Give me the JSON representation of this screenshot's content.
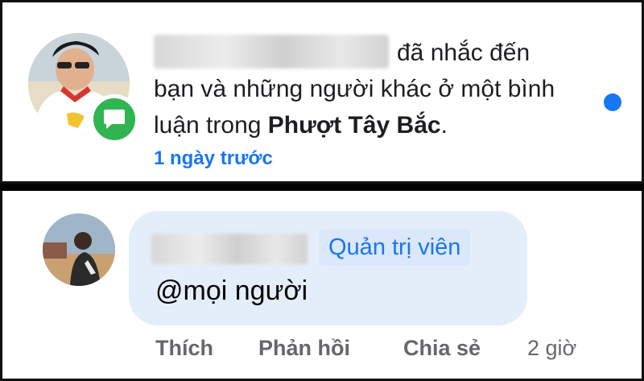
{
  "notification": {
    "text_mid": "đã nhắc đến bạn và những người khác ở một bình luận trong",
    "group_name": "Phượt Tây Bắc",
    "text_end": ".",
    "time_ago": "1 ngày trước",
    "badge_icon": "message-bubble-icon",
    "accent_color": "#1877f2",
    "badge_color": "#2fb551"
  },
  "comment": {
    "admin_label": "Quản trị viên",
    "body": "@mọi người",
    "actions": {
      "like": "Thích",
      "reply": "Phản hồi",
      "share": "Chia sẻ",
      "time": "2 giờ"
    }
  }
}
